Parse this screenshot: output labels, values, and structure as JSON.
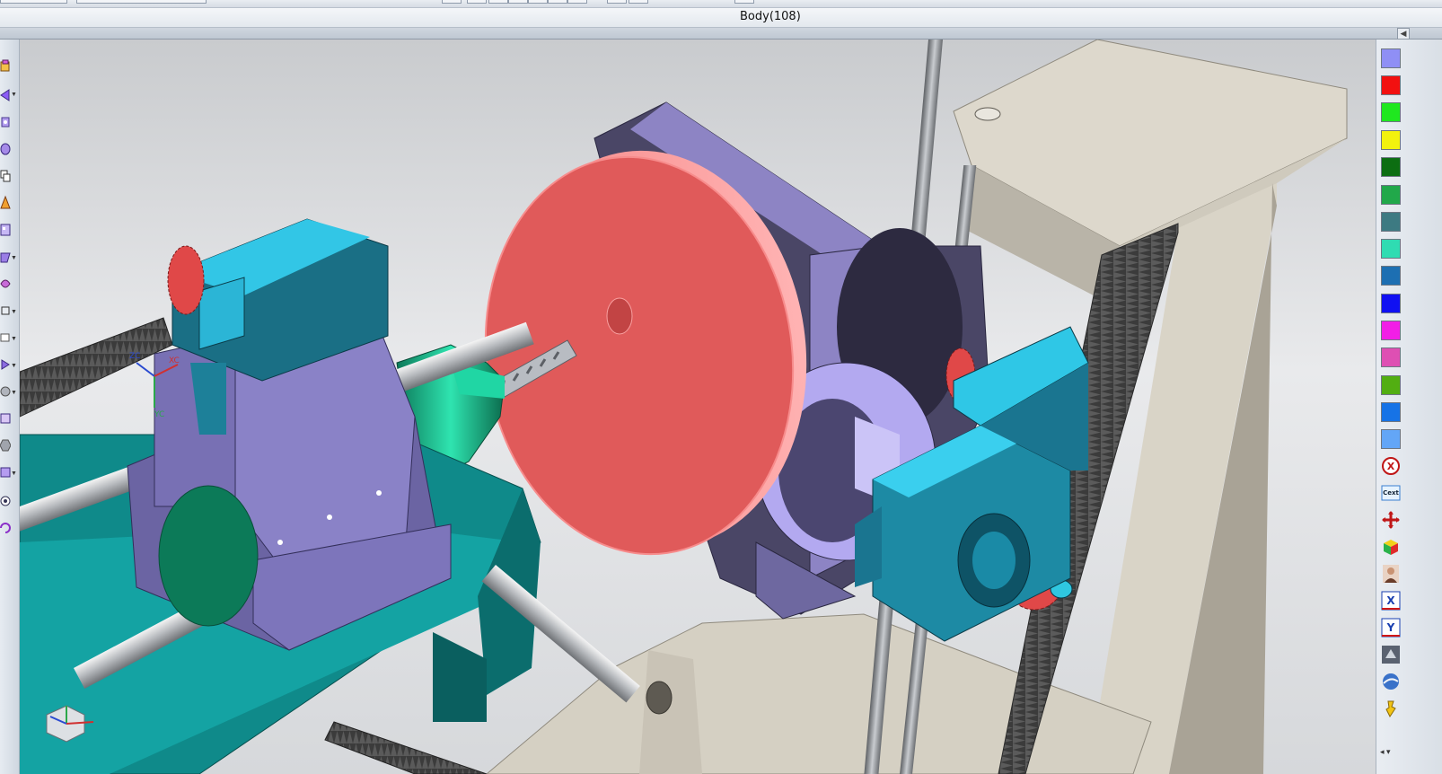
{
  "window": {
    "title": "Body(108)"
  },
  "palette": {
    "swatches": [
      {
        "name": "lavender",
        "color": "#8f8ff5"
      },
      {
        "name": "red",
        "color": "#f21010"
      },
      {
        "name": "green",
        "color": "#1fe81f"
      },
      {
        "name": "yellow",
        "color": "#f2f20e"
      },
      {
        "name": "dark-green",
        "color": "#0c6e12"
      },
      {
        "name": "medium-green",
        "color": "#21a84a"
      },
      {
        "name": "slate-teal",
        "color": "#3d7a82"
      },
      {
        "name": "aquamarine",
        "color": "#2fdcb2"
      },
      {
        "name": "steel-blue",
        "color": "#1d6fb2"
      },
      {
        "name": "blue",
        "color": "#1010f2"
      },
      {
        "name": "magenta",
        "color": "#f21ee6"
      },
      {
        "name": "pink",
        "color": "#de4fb3"
      },
      {
        "name": "lime-green",
        "color": "#52ae12"
      },
      {
        "name": "azure",
        "color": "#1673e6"
      },
      {
        "name": "light-blue",
        "color": "#63a6f7"
      }
    ],
    "tools": [
      {
        "icon": "close-circle-icon",
        "label": "X"
      },
      {
        "icon": "cext-icon",
        "label": "Cext"
      },
      {
        "icon": "move-arrows-icon",
        "label": ""
      },
      {
        "icon": "color-cube-icon",
        "label": ""
      },
      {
        "icon": "portrait-icon",
        "label": ""
      },
      {
        "icon": "x-axis-icon",
        "label": "X"
      },
      {
        "icon": "y-axis-icon",
        "label": "Y"
      },
      {
        "icon": "view-3d-icon",
        "label": ""
      },
      {
        "icon": "sphere-icon",
        "label": ""
      },
      {
        "icon": "yellow-tool-icon",
        "label": ""
      }
    ]
  },
  "viewport": {
    "csys_labels": {
      "z": "ZC",
      "x": "XC",
      "y": "YC"
    }
  }
}
